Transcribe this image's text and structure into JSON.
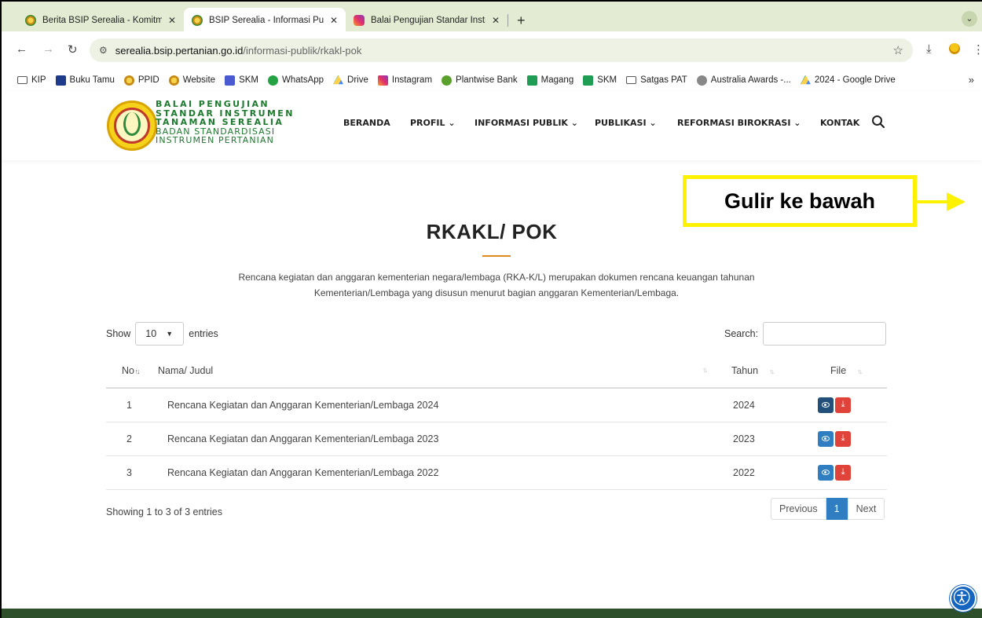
{
  "browser": {
    "tabs": [
      {
        "title": "Berita BSIP Serealia - Komitm",
        "favicon": "bsip-logo-icon",
        "close": "✕"
      },
      {
        "title": "BSIP Serealia - Informasi Publ",
        "favicon": "bsip-logo-icon",
        "close": "✕"
      },
      {
        "title": "Balai Pengujian Standar Instru",
        "favicon": "instagram-icon",
        "close": "✕"
      }
    ],
    "new_tab": "+",
    "address": {
      "host": "serealia.bsip.pertanian.go.id",
      "path": "/informasi-publik/rkakl-pok"
    },
    "bookmarks": [
      {
        "label": "KIP",
        "icon": "folder-icon"
      },
      {
        "label": "Buku Tamu",
        "icon": "bookmark-icon"
      },
      {
        "label": "PPID",
        "icon": "bsip-logo-icon"
      },
      {
        "label": "Website",
        "icon": "bsip-logo-icon"
      },
      {
        "label": "SKM",
        "icon": "sheet-icon"
      },
      {
        "label": "WhatsApp",
        "icon": "whatsapp-icon"
      },
      {
        "label": "Drive",
        "icon": "drive-icon"
      },
      {
        "label": "Instagram",
        "icon": "instagram-icon"
      },
      {
        "label": "Plantwise Bank",
        "icon": "plantwise-icon"
      },
      {
        "label": "Magang",
        "icon": "plus-sheet-icon"
      },
      {
        "label": "SKM",
        "icon": "plus-sheet-icon"
      },
      {
        "label": "Satgas PAT",
        "icon": "folder-icon"
      },
      {
        "label": "Australia Awards -...",
        "icon": "award-icon"
      },
      {
        "label": "2024 - Google Drive",
        "icon": "drive-icon"
      }
    ],
    "bookmarks_more": "»"
  },
  "site": {
    "brand_lines_bold": [
      "BALAI PENGUJIAN",
      "STANDAR INSTRUMEN",
      "TANAMAN SEREALIA"
    ],
    "brand_lines_regular": [
      "BADAN STANDARDISASI",
      "INSTRUMEN PERTANIAN"
    ],
    "nav": [
      {
        "label": "BERANDA"
      },
      {
        "label": "PROFIL ⌄"
      },
      {
        "label": "INFORMASI PUBLIK ⌄"
      },
      {
        "label": "PUBLIKASI ⌄"
      },
      {
        "label": "REFORMASI BIROKRASI ⌄"
      },
      {
        "label": "KONTAK"
      }
    ]
  },
  "page": {
    "title": "RKAKL/ POK",
    "description_line1": "Rencana kegiatan dan anggaran kementerian negara/lembaga (RKA-K/L) merupakan dokumen rencana keuangan tahunan",
    "description_line2": "Kementerian/Lembaga yang disusun menurut bagian anggaran Kementerian/Lembaga."
  },
  "callout": {
    "text": "Gulir ke bawah"
  },
  "table_controls": {
    "show_label": "Show",
    "entries_value": "10",
    "entries_label": "entries",
    "search_label": "Search:"
  },
  "table": {
    "headers": {
      "no": "No",
      "name": "Nama/ Judul",
      "year": "Tahun",
      "file": "File"
    },
    "rows": [
      {
        "no": "1",
        "name": "Rencana Kegiatan dan Anggaran Kementerian/Lembaga 2024",
        "year": "2024"
      },
      {
        "no": "2",
        "name": "Rencana Kegiatan dan Anggaran Kementerian/Lembaga 2023",
        "year": "2023"
      },
      {
        "no": "3",
        "name": "Rencana Kegiatan dan Anggaran Kementerian/Lembaga 2022",
        "year": "2022"
      }
    ]
  },
  "footer_info": "Showing 1 to 3 of 3 entries",
  "pagination": {
    "previous": "Previous",
    "current": "1",
    "next": "Next"
  },
  "colors": {
    "brand_green": "#1d7a2e",
    "accent_orange": "#e08a1b",
    "primary_blue": "#2f7ec1",
    "danger_red": "#e0433a",
    "callout_yellow": "#fff200",
    "footer_green": "#2d4f2a"
  }
}
